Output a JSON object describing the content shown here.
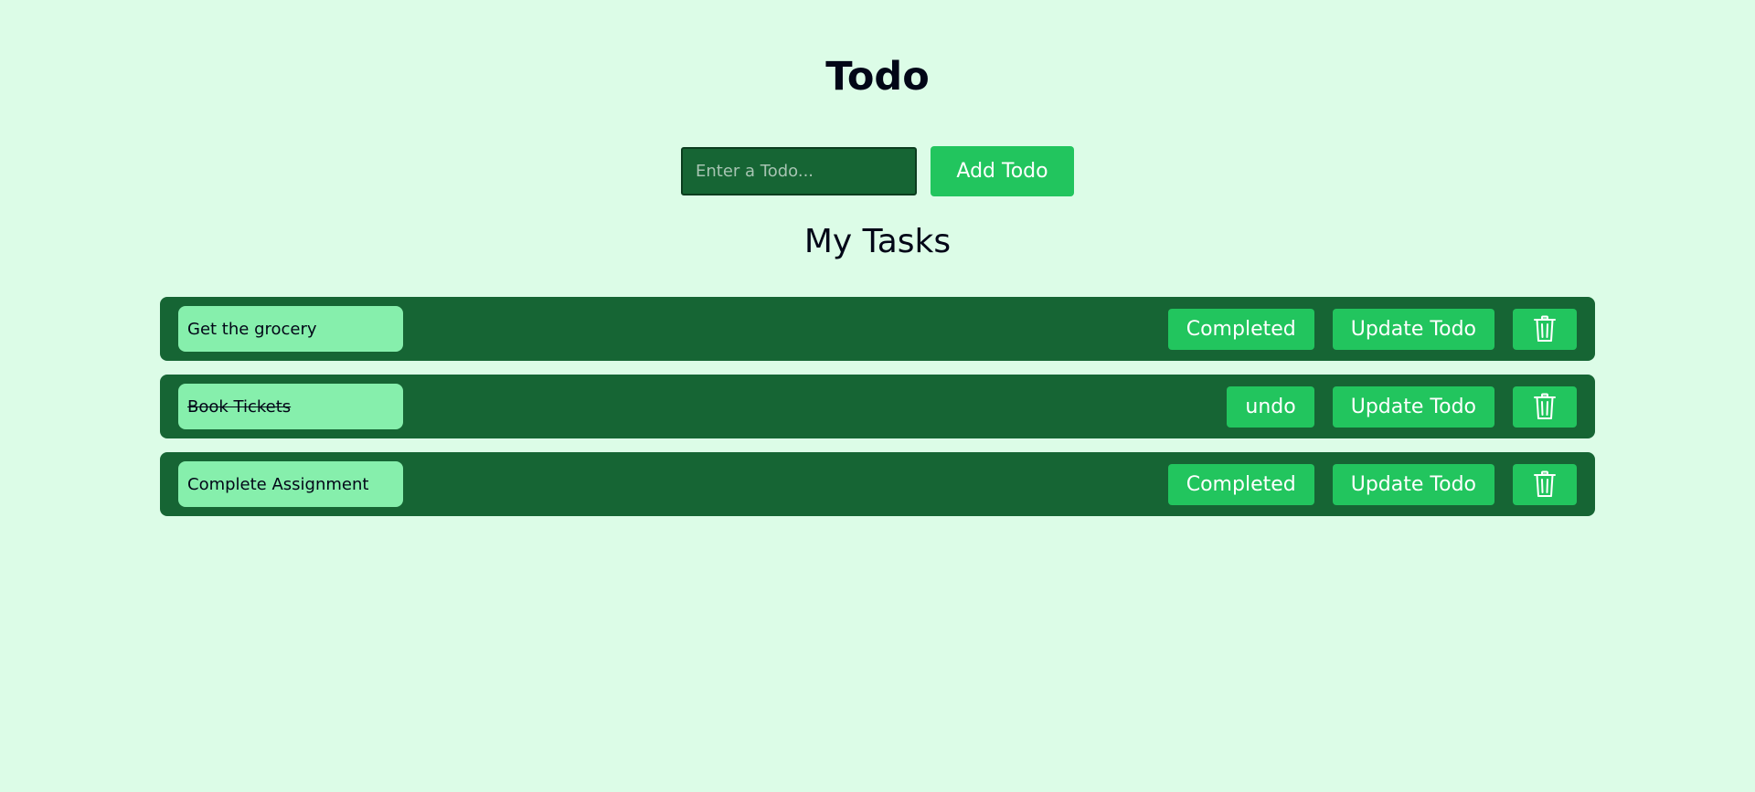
{
  "header": {
    "title": "Todo"
  },
  "add_form": {
    "placeholder": "Enter a Todo...",
    "add_label": "Add Todo"
  },
  "tasks_section": {
    "title": "My Tasks"
  },
  "tasks": [
    {
      "text": "Get the grocery",
      "completed": false,
      "status_label": "Completed",
      "update_label": "Update Todo",
      "delete_icon": "trash-icon"
    },
    {
      "text": "Book Tickets",
      "completed": true,
      "status_label": "undo",
      "update_label": "Update Todo",
      "delete_icon": "trash-icon"
    },
    {
      "text": "Complete Assignment",
      "completed": false,
      "status_label": "Completed",
      "update_label": "Update Todo",
      "delete_icon": "trash-icon"
    }
  ],
  "colors": {
    "background": "#dcfce7",
    "row": "#166534",
    "accent": "#22c55e",
    "task_field": "#86efac"
  }
}
